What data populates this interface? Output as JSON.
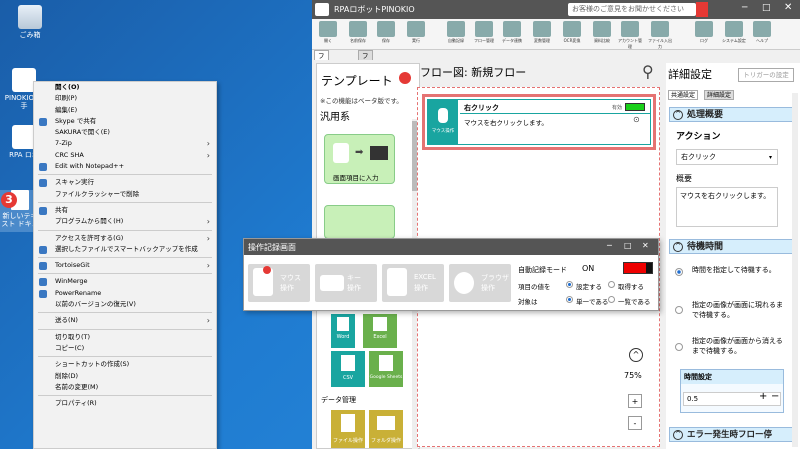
{
  "desktop": {
    "icons": [
      {
        "label": "ごみ箱"
      },
      {
        "label": "PINOKIO 速手"
      },
      {
        "label": "RPA ロボ"
      },
      {
        "label": "新しいテキスト ドキュ"
      }
    ],
    "step_badge": "3"
  },
  "context_menu": {
    "items": [
      {
        "label": "開く(O)",
        "bold": true
      },
      {
        "label": "印刷(P)"
      },
      {
        "label": "編集(E)"
      },
      {
        "label": "Skype で共有",
        "icon": "skype-icon"
      },
      {
        "label": "SAKURAで開く(E)"
      },
      {
        "label": "7-Zip",
        "sub": true
      },
      {
        "label": "CRC SHA",
        "sub": true
      },
      {
        "label": "Edit with Notepad++",
        "icon": "notepadpp-icon"
      },
      {
        "sep": true
      },
      {
        "label": "スキャン実行",
        "icon": "scan-icon"
      },
      {
        "label": "ファイルクラッシャーで削除"
      },
      {
        "sep": true
      },
      {
        "label": "共有",
        "icon": "share-icon"
      },
      {
        "label": "プログラムから開く(H)",
        "sub": true
      },
      {
        "sep": true
      },
      {
        "label": "アクセスを許可する(G)",
        "sub": true
      },
      {
        "label": "選択したファイルでスマートバックアップを作成",
        "icon": "backup-icon"
      },
      {
        "sep": true
      },
      {
        "label": "TortoiseGit",
        "icon": "tortoisegit-icon",
        "sub": true
      },
      {
        "sep": true
      },
      {
        "label": "WinMerge",
        "icon": "winmerge-icon"
      },
      {
        "label": "PowerRename",
        "icon": "powerrename-icon"
      },
      {
        "label": "以前のバージョンの復元(V)"
      },
      {
        "sep": true
      },
      {
        "label": "送る(N)",
        "sub": true
      },
      {
        "sep": true
      },
      {
        "label": "切り取り(T)"
      },
      {
        "label": "コピー(C)"
      },
      {
        "sep": true
      },
      {
        "label": "ショートカットの作成(S)"
      },
      {
        "label": "削除(D)"
      },
      {
        "label": "名前の変更(M)"
      },
      {
        "sep": true
      },
      {
        "label": "プロパティ(R)"
      }
    ]
  },
  "app": {
    "title": "RPAロボットPINOKIO",
    "feedback": "お客様のご意見をお聞かせください",
    "ribbon": [
      "開く",
      "名前保存",
      "保存",
      "実行",
      "自動記録",
      "フロー管理",
      "データ連携",
      "変数管理",
      "OCR変換",
      "資料比較",
      "アカウント管理",
      "ファイル入出力",
      "ログ",
      "システム設定",
      "ヘルプ"
    ],
    "tabs": [
      "フロー作成",
      "フロー設定"
    ],
    "template": {
      "title": "テンプレート",
      "note": "※この機能はベータ版です。",
      "category": "汎用系",
      "tile1": "画面項目に入力",
      "cat2": "データ管理",
      "small_tiles": [
        "Word",
        "Excel",
        "CSV",
        "Google Sheets",
        "ファイル操作",
        "フォルダ操作"
      ]
    },
    "flow": {
      "title": "フロー図: 新規フロー",
      "card_title": "右クリック",
      "card_desc": "マウスを右クリックします。",
      "card_state": "有効",
      "card_icon_label": "マウス操作",
      "zoom": "75%"
    },
    "detail": {
      "title": "詳細設定",
      "trigger": "トリガーの設定",
      "tabs": [
        "共通設定",
        "詳細設定"
      ],
      "sec1": "処理概要",
      "action_label": "アクション",
      "action_value": "右クリック",
      "summary_label": "概要",
      "summary_value": "マウスを右クリックします。",
      "sec2": "待機時間",
      "opt1": "時間を指定して待機する。",
      "opt2": "指定の画像が画面に現れるまで待機する。",
      "opt3": "指定の画像が画面から消えるまで待機する。",
      "time_label": "時間設定",
      "time_value": "0.5",
      "sec3": "エラー発生時フロー停"
    }
  },
  "recorder": {
    "title": "操作記録画面",
    "buttons": [
      {
        "line1": "マウス",
        "line2": "操作"
      },
      {
        "line1": "キー",
        "line2": "操作"
      },
      {
        "line1": "EXCEL",
        "line2": "操作"
      },
      {
        "line1": "ブラウザ",
        "line2": "操作"
      }
    ],
    "auto_label": "自動記録モード",
    "auto_value": "ON",
    "value_label": "項目の値を",
    "set": "設定する",
    "get": "取得する",
    "target_label": "対象は",
    "single": "単一である",
    "list": "一覧である"
  },
  "colors": {
    "accent": "#e53935",
    "teal": "#19a5a0",
    "blue": "#2a7fd4"
  }
}
